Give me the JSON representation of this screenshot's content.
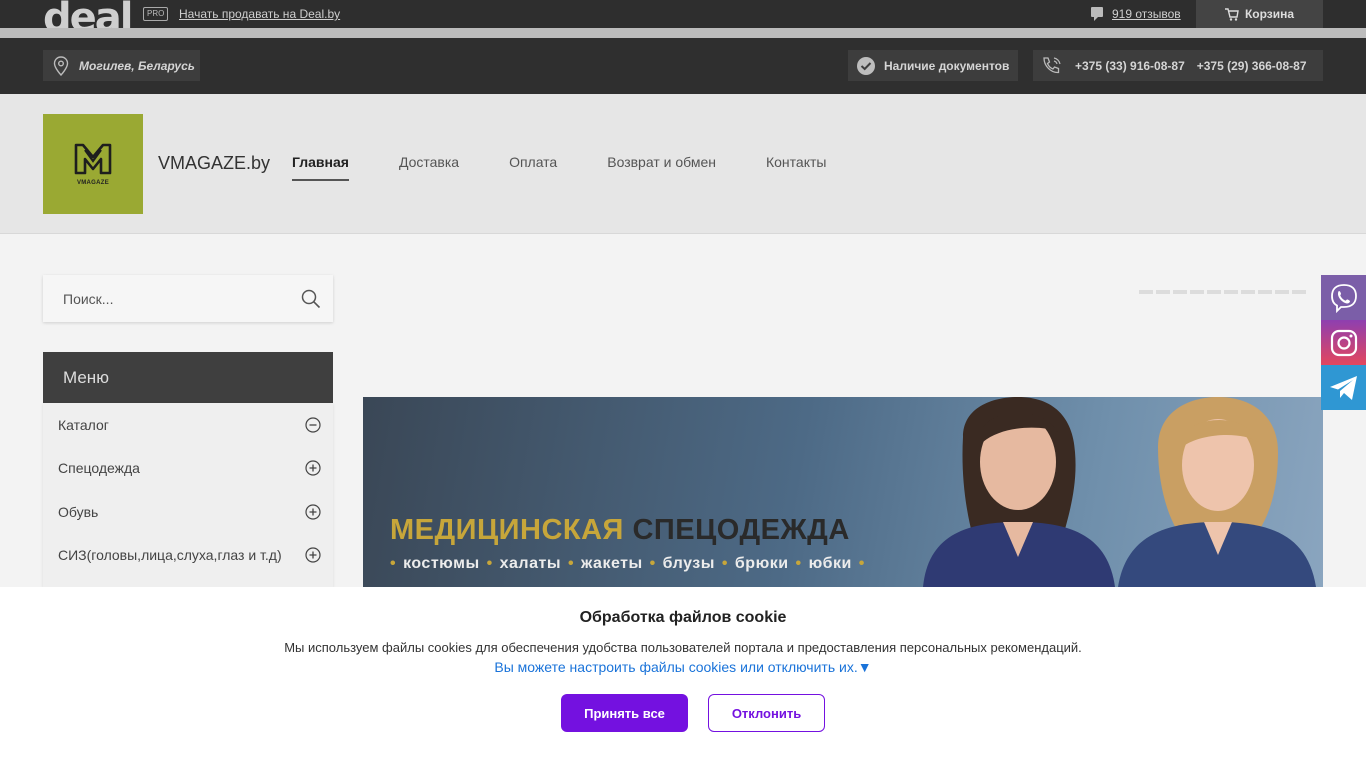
{
  "topbar": {
    "logo_text": "deal",
    "pro_badge": "PRO",
    "sell_link": "Начать продавать на Deal.by",
    "reviews": "919 отзывов",
    "cart": "Корзина"
  },
  "infobar": {
    "location": "Могилев, Беларусь",
    "documents": "Наличие документов",
    "phone_1": "+375 (33) 916-08-87",
    "phone_2": "+375 (29) 366-08-87"
  },
  "header": {
    "logo_caption": "VMAGAZE",
    "shop_name": "VMAGAZE.by",
    "nav": [
      {
        "label": "Главная",
        "active": true
      },
      {
        "label": "Доставка"
      },
      {
        "label": "Оплата"
      },
      {
        "label": "Возврат и обмен"
      },
      {
        "label": "Контакты"
      }
    ]
  },
  "search": {
    "placeholder": "Поиск..."
  },
  "menu": {
    "title": "Меню",
    "items": [
      {
        "label": "Каталог",
        "state": "expanded"
      },
      {
        "label": "Спецодежда",
        "state": "collapsed"
      },
      {
        "label": "Обувь",
        "state": "collapsed"
      },
      {
        "label": "СИЗ(головы,лица,слуха,глаз и т.д)",
        "state": "collapsed"
      }
    ]
  },
  "banner": {
    "title_part_1": "МЕДИЦИНСКАЯ",
    "title_part_2": "СПЕЦОДЕЖДА",
    "items": [
      "костюмы",
      "халаты",
      "жакеты",
      "блузы",
      "брюки",
      "юбки"
    ]
  },
  "cookie": {
    "title": "Обработка файлов cookie",
    "text": "Мы используем файлы cookies для обеспечения удобства пользователей портала и предоставления персональных рекомендаций.",
    "link": "Вы можете настроить файлы cookies или отключить их.▼",
    "accept": "Принять все",
    "decline": "Отклонить"
  },
  "colors": {
    "accent_purple": "#7411e0",
    "logo_green": "#9aa933",
    "viber": "#7b5ea8",
    "telegram": "#2f97d3"
  }
}
